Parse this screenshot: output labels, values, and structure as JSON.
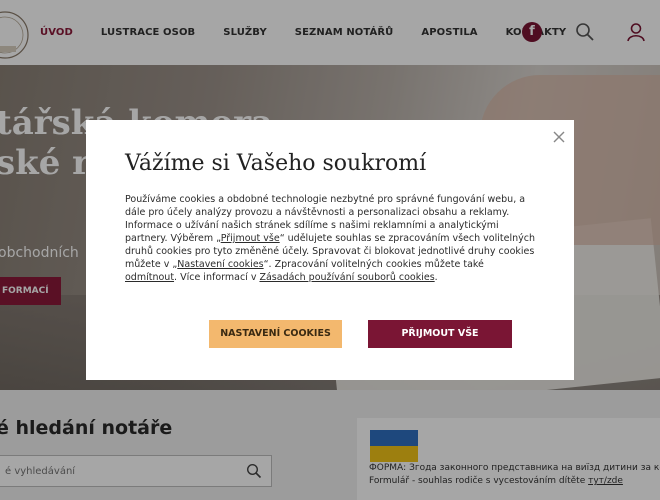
{
  "nav": {
    "items": [
      "ÚVOD",
      "LUSTRACE OSOB",
      "SLUŽBY",
      "SEZNAM NOTÁŘŮ",
      "APOSTILA",
      "KONTAKTY"
    ],
    "active_index": 0,
    "facebook_glyph": "f"
  },
  "hero": {
    "title_line1": "tářská komora",
    "title_line2": "ské re",
    "subtitle": "obchodních",
    "button_label": "FORMACÍ"
  },
  "search": {
    "title": "é hledání notáře",
    "placeholder": "é vyhledávání"
  },
  "news_card": {
    "line1": "ФОРМА: Згода законного представника на виїзд дитини за кордон",
    "line2_text": "Formulář - souhlas rodiče s vycestováním dítěte ",
    "line2_link": "тут/zde"
  },
  "cookie_modal": {
    "title": "Vážíme si Vašeho soukromí",
    "text_part1": "Používáme cookies a obdobné technologie nezbytné pro správné fungování webu, a dále pro účely analýzy provozu a návštěvnosti a personalizaci obsahu a reklamy. Informace o užívání našich stránek sdílíme s našimi reklamními a analytickými partnery. Výběrem „",
    "link_accept_all": "Přijmout vše",
    "text_part2": "“ udělujete souhlas se zpracováním všech volitelných druhů cookies pro tyto změněné účely. Spravovat či blokovat jednotlivé druhy cookies můžete v „",
    "link_settings": "Nastavení cookies",
    "text_part3": "“. Zpracování volitelných cookies můžete také ",
    "link_revoke": "odmítnout",
    "text_part4": ". Více informací v ",
    "link_policy": "Zásadách používání souborů cookies",
    "text_part5": ".",
    "button_settings": "NASTAVENÍ COOKIES",
    "button_accept": "PŘIJMOUT VŠE"
  },
  "colors": {
    "brand": "#8b1a3a",
    "settings_button": "#f3b86e",
    "accept_button": "#7a1534"
  }
}
